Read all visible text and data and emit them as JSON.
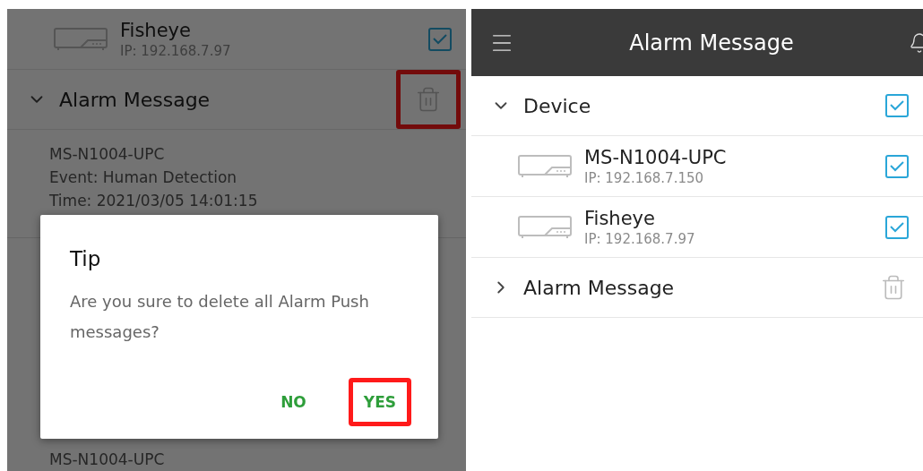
{
  "left_screen": {
    "devices": [
      {
        "name": "Fisheye",
        "ip": "IP: 192.168.7.97",
        "checked": true
      }
    ],
    "alarm_section": {
      "title": "Alarm Message",
      "expanded": true,
      "delete_highlighted": true
    },
    "messages": [
      {
        "lines": [
          "MS-N1004-UPC",
          "Event: Human Detection",
          "Time: 2021/03/05 14:01:15"
        ]
      },
      {
        "lines": [
          "MS-N1004-UPC"
        ]
      }
    ],
    "dialog": {
      "title": "Tip",
      "message": "Are you sure to delete all Alarm Push messages?",
      "buttons": [
        {
          "label": "NO",
          "highlighted": false
        },
        {
          "label": "YES",
          "highlighted": true
        }
      ]
    }
  },
  "right_screen": {
    "header": {
      "title": "Alarm Message"
    },
    "device_section": {
      "title": "Device",
      "expanded": true,
      "checked": true,
      "devices": [
        {
          "name": "MS-N1004-UPC",
          "ip": "IP: 192.168.7.150",
          "checked": true
        },
        {
          "name": "Fisheye",
          "ip": "IP: 192.168.7.97",
          "checked": true
        }
      ]
    },
    "alarm_section": {
      "title": "Alarm Message",
      "expanded": false,
      "delete_highlighted": false
    }
  }
}
